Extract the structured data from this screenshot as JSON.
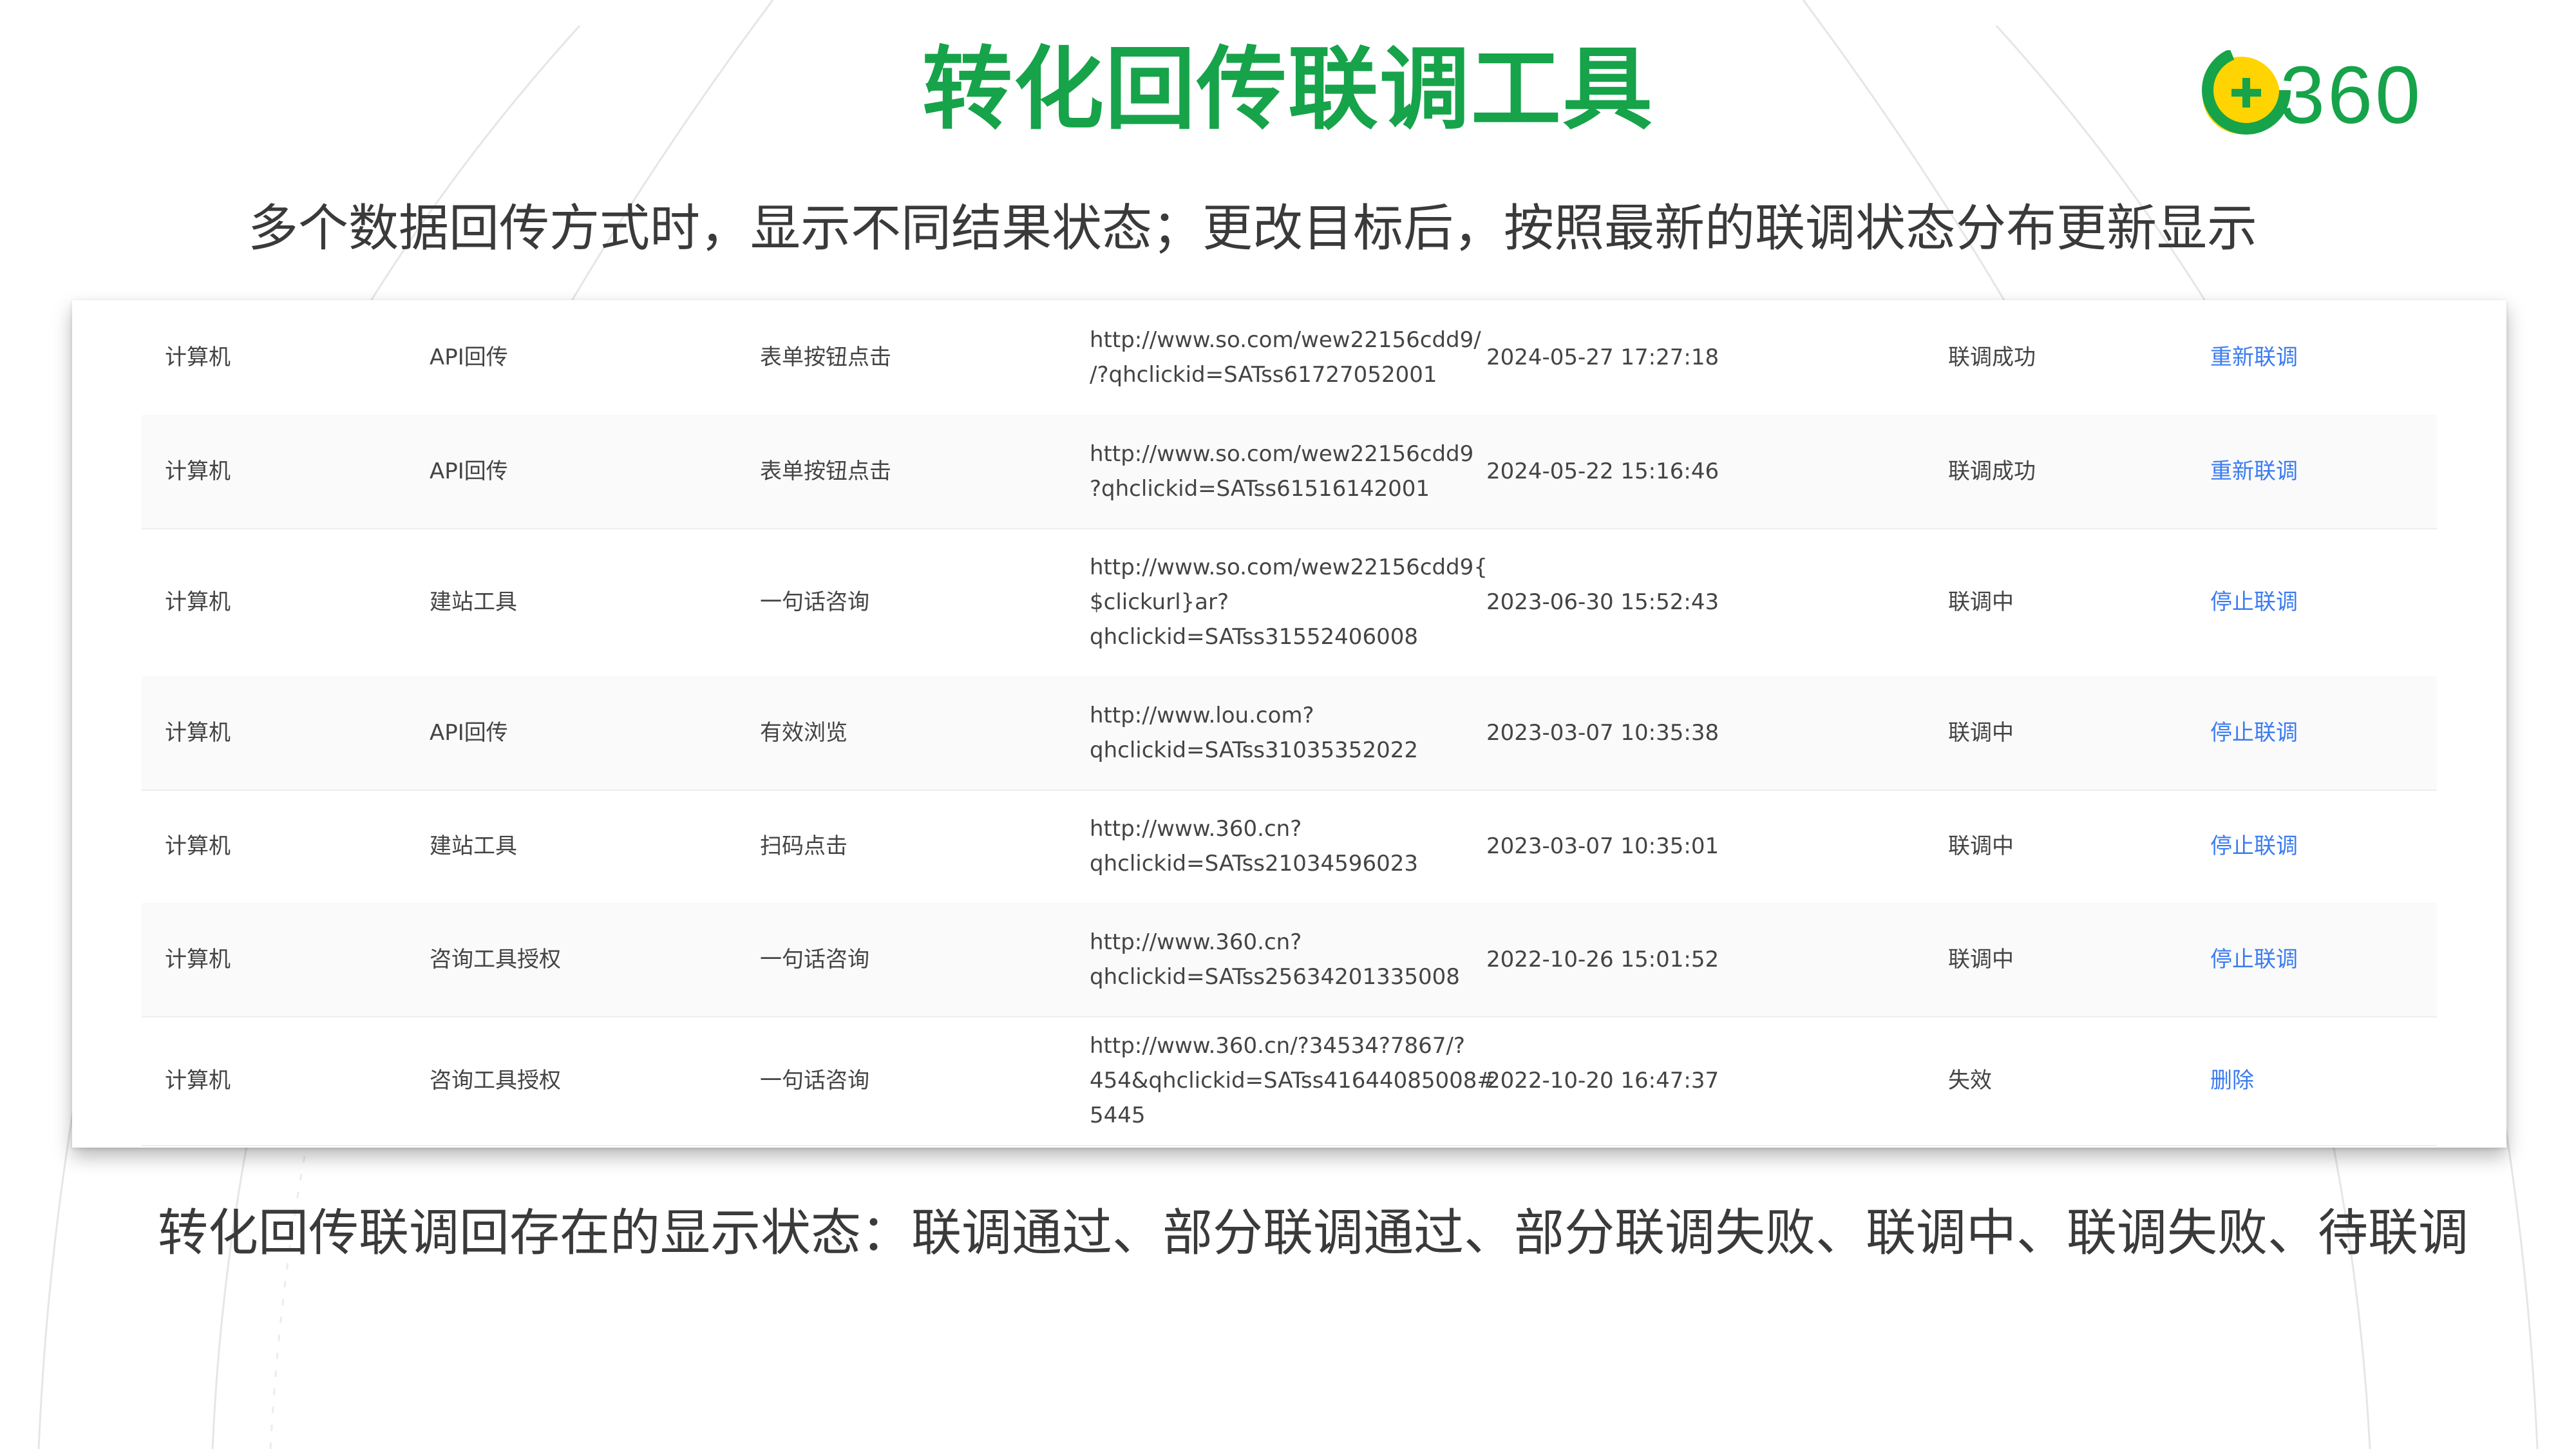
{
  "title": "转化回传联调工具",
  "subtitle": "多个数据回传方式时，显示不同结果状态；更改目标后，按照最新的联调状态分布更新显示",
  "logo": {
    "text": "360",
    "icon": "360-plus-logo-icon"
  },
  "colors": {
    "brand_green": "#16a34a",
    "logo_yellow": "#ffd400",
    "link_blue": "#3b7cf0"
  },
  "table": {
    "rows": [
      {
        "device": "计算机",
        "method": "API回传",
        "event": "表单按钮点击",
        "url": [
          "http://www.so.com/wew22156cdd9/",
          "/?qhclickid=SATss61727052001"
        ],
        "time": "2024-05-27 17:27:18",
        "status": "联调成功",
        "action": "重新联调"
      },
      {
        "device": "计算机",
        "method": "API回传",
        "event": "表单按钮点击",
        "url": [
          "http://www.so.com/wew22156cdd9",
          "?qhclickid=SATss61516142001"
        ],
        "time": "2024-05-22 15:16:46",
        "status": "联调成功",
        "action": "重新联调"
      },
      {
        "device": "计算机",
        "method": "建站工具",
        "event": "一句话咨询",
        "url": [
          "http://www.so.com/wew22156cdd9{",
          "$clickurl}ar?",
          "qhclickid=SATss31552406008"
        ],
        "time": "2023-06-30 15:52:43",
        "status": "联调中",
        "action": "停止联调"
      },
      {
        "device": "计算机",
        "method": "API回传",
        "event": "有效浏览",
        "url": [
          "http://www.lou.com?",
          "qhclickid=SATss31035352022"
        ],
        "time": "2023-03-07 10:35:38",
        "status": "联调中",
        "action": "停止联调"
      },
      {
        "device": "计算机",
        "method": "建站工具",
        "event": "扫码点击",
        "url": [
          "http://www.360.cn?",
          "qhclickid=SATss21034596023"
        ],
        "time": "2023-03-07 10:35:01",
        "status": "联调中",
        "action": "停止联调"
      },
      {
        "device": "计算机",
        "method": "咨询工具授权",
        "event": "一句话咨询",
        "url": [
          "http://www.360.cn?",
          "qhclickid=SATss25634201335008"
        ],
        "time": "2022-10-26 15:01:52",
        "status": "联调中",
        "action": "停止联调"
      },
      {
        "device": "计算机",
        "method": "咨询工具授权",
        "event": "一句话咨询",
        "url": [
          "http://www.360.cn/?34534?7867/?",
          "454&qhclickid=SATss41644085008#",
          "5445"
        ],
        "time": "2022-10-20 16:47:37",
        "status": "失效",
        "action": "删除"
      }
    ]
  },
  "footer": "转化回传联调回存在的显示状态：联调通过、部分联调通过、部分联调失败、联调中、联调失败、待联调"
}
